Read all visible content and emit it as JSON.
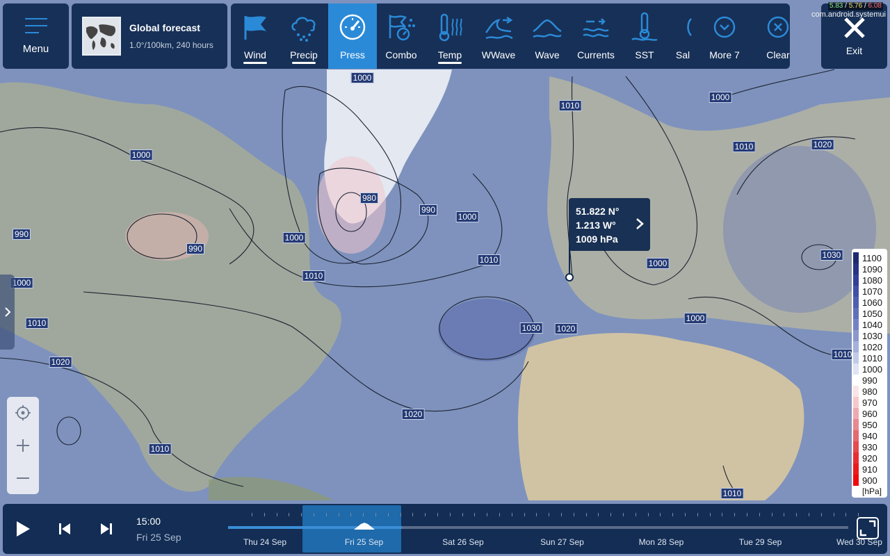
{
  "top_bar": {
    "menu_label": "Menu",
    "forecast_title": "Global forecast",
    "forecast_sub": "1.0°/100km, 240 hours",
    "layers": [
      {
        "label": "Wind",
        "icon": "wind-flag-icon",
        "active": false,
        "underline": true
      },
      {
        "label": "Precip",
        "icon": "rain-cloud-icon",
        "active": false,
        "underline": true
      },
      {
        "label": "Press",
        "icon": "gauge-icon",
        "active": true,
        "underline": false
      },
      {
        "label": "Combo",
        "icon": "combo-icon",
        "active": false,
        "underline": false
      },
      {
        "label": "Temp",
        "icon": "thermometer-heat-icon",
        "active": false,
        "underline": true
      },
      {
        "label": "WWave",
        "icon": "wind-wave-icon",
        "active": false,
        "underline": false
      },
      {
        "label": "Wave",
        "icon": "wave-icon",
        "active": false,
        "underline": false
      },
      {
        "label": "Currents",
        "icon": "currents-icon",
        "active": false,
        "underline": false
      },
      {
        "label": "SST",
        "icon": "sea-thermometer-icon",
        "active": false,
        "underline": false
      },
      {
        "label": "Sal",
        "icon": "salinity-icon",
        "active": false,
        "underline": false
      },
      {
        "label": "More 7",
        "icon": "chevron-circle-down-icon",
        "active": false,
        "underline": false
      },
      {
        "label": "Clear",
        "icon": "close-circle-icon",
        "active": false,
        "underline": false
      }
    ],
    "exit_label": "Exit"
  },
  "system": {
    "stats": [
      {
        "text": "5.83",
        "color": "#8df08d"
      },
      {
        "text": " / ",
        "color": "#ffffff"
      },
      {
        "text": "5.76",
        "color": "#f4e06a"
      },
      {
        "text": " / ",
        "color": "#ffffff"
      },
      {
        "text": "6.08",
        "color": "#ff6e6e"
      }
    ],
    "app": "com.android.systemui"
  },
  "map": {
    "isobar_labels": [
      "1000",
      "1010",
      "1000",
      "1020",
      "1010",
      "1000",
      "980",
      "990",
      "1000",
      "990",
      "1000",
      "1000",
      "990",
      "1000",
      "1010",
      "1010",
      "1010",
      "1030",
      "1020",
      "1030",
      "1000",
      "1010",
      "1010",
      "1020",
      "1020",
      "1010",
      "1010"
    ]
  },
  "point_popup": {
    "lat": "51.822 N°",
    "lon": "1.213 W°",
    "value": "1009 hPa"
  },
  "legend": {
    "unit": "[hPa]",
    "items": [
      {
        "value": "1100",
        "color": "#1f2a6e"
      },
      {
        "value": "1090",
        "color": "#283384"
      },
      {
        "value": "1080",
        "color": "#333f97"
      },
      {
        "value": "1070",
        "color": "#4050a5"
      },
      {
        "value": "1060",
        "color": "#4e5fae"
      },
      {
        "value": "1050",
        "color": "#5f70b8"
      },
      {
        "value": "1040",
        "color": "#7482c4"
      },
      {
        "value": "1030",
        "color": "#8b98cf"
      },
      {
        "value": "1020",
        "color": "#a5b0dc"
      },
      {
        "value": "1010",
        "color": "#c2cae8"
      },
      {
        "value": "1000",
        "color": "#dfe3f3"
      },
      {
        "value": "990",
        "color": "#ffffff"
      },
      {
        "value": "980",
        "color": "#fbe4e6"
      },
      {
        "value": "970",
        "color": "#f6c8cc"
      },
      {
        "value": "960",
        "color": "#efaab0"
      },
      {
        "value": "950",
        "color": "#e68990"
      },
      {
        "value": "940",
        "color": "#e36a70"
      },
      {
        "value": "930",
        "color": "#e44a50"
      },
      {
        "value": "920",
        "color": "#e72f33"
      },
      {
        "value": "910",
        "color": "#ea1a1d"
      },
      {
        "value": "900",
        "color": "#ee0a0c"
      }
    ]
  },
  "timeline": {
    "time": "15:00",
    "date": "Fri 25 Sep",
    "progress": 0.28,
    "days": [
      "Thu 24 Sep",
      "Fri 25 Sep",
      "Sat 26 Sep",
      "Sun 27 Sep",
      "Mon 28 Sep",
      "Tue 29 Sep",
      "Wed 30 Sep"
    ],
    "selected_day": "Fri 25 Sep"
  },
  "colors": {
    "panel": "#0e284e",
    "accent": "#2b8ad8",
    "label_bg": "#243a75"
  }
}
